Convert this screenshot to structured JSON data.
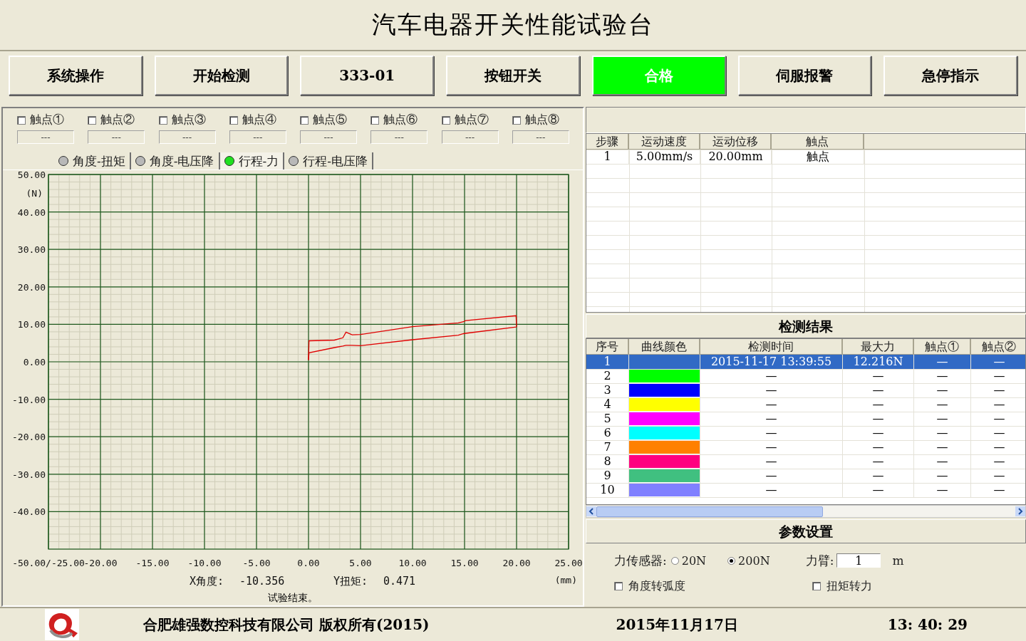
{
  "title": "汽车电器开关性能试验台",
  "buttons": [
    {
      "label": "系统操作",
      "active": false
    },
    {
      "label": "开始检测",
      "active": false
    },
    {
      "label": "333-01",
      "active": false
    },
    {
      "label": "按钮开关",
      "active": false
    },
    {
      "label": "合格",
      "active": true
    },
    {
      "label": "伺服报警",
      "active": false
    },
    {
      "label": "急停指示",
      "active": false
    }
  ],
  "contacts": [
    {
      "label": "触点①",
      "checked": false,
      "value": "---"
    },
    {
      "label": "触点②",
      "checked": false,
      "value": "---"
    },
    {
      "label": "触点③",
      "checked": false,
      "value": "---"
    },
    {
      "label": "触点④",
      "checked": false,
      "value": "---"
    },
    {
      "label": "触点⑤",
      "checked": false,
      "value": "---"
    },
    {
      "label": "触点⑥",
      "checked": false,
      "value": "---"
    },
    {
      "label": "触点⑦",
      "checked": false,
      "value": "---"
    },
    {
      "label": "触点⑧",
      "checked": false,
      "value": "---"
    }
  ],
  "chart_tabs": [
    {
      "label": "角度-扭矩",
      "selected": false
    },
    {
      "label": "角度-电压降",
      "selected": false
    },
    {
      "label": "行程-力",
      "selected": true
    },
    {
      "label": "行程-电压降",
      "selected": false
    }
  ],
  "chart": {
    "chart_data": {
      "type": "line",
      "xlabel": "(mm)",
      "ylabel": "(N)",
      "xlim": [
        -25,
        25
      ],
      "ylim": [
        -50,
        50
      ],
      "xticks": [
        {
          "value": -25,
          "label": "-50.00/-25.00"
        },
        {
          "value": -20,
          "label": "-20.00"
        },
        {
          "value": -15,
          "label": "-15.00"
        },
        {
          "value": -10,
          "label": "-10.00"
        },
        {
          "value": -5,
          "label": "-5.00"
        },
        {
          "value": 0,
          "label": "0.00"
        },
        {
          "value": 5,
          "label": "5.00"
        },
        {
          "value": 10,
          "label": "10.00"
        },
        {
          "value": 15,
          "label": "15.00"
        },
        {
          "value": 20,
          "label": "20.00"
        },
        {
          "value": 25,
          "label": "25.00"
        }
      ],
      "yticks": [
        {
          "value": 50,
          "label": "50.00"
        },
        {
          "value": 40,
          "label": "40.00"
        },
        {
          "value": 30,
          "label": "30.00"
        },
        {
          "value": 20,
          "label": "20.00"
        },
        {
          "value": 10,
          "label": "10.00"
        },
        {
          "value": 0,
          "label": "0.00"
        },
        {
          "value": -10,
          "label": "-10.00"
        },
        {
          "value": -20,
          "label": "-20.00"
        },
        {
          "value": -30,
          "label": "-30.00"
        },
        {
          "value": -40,
          "label": "-40.00"
        }
      ],
      "grid": true,
      "x": [
        0,
        0.05,
        2.5,
        3.3,
        3.6,
        4.2,
        5,
        10,
        14.4,
        14.9,
        15.1,
        19.95,
        20
      ],
      "series": [
        {
          "color": "#e00000",
          "values": [
            0.5,
            5.6,
            5.8,
            6.4,
            7.9,
            7.2,
            7.3,
            9.4,
            10.4,
            10.7,
            11.0,
            12.3,
            9.4
          ]
        },
        {
          "color": "#e00000",
          "values": [
            0.5,
            2.4,
            3.8,
            4.2,
            4.4,
            4.4,
            4.3,
            5.9,
            7.1,
            7.5,
            7.6,
            9.3,
            9.4
          ]
        }
      ]
    },
    "readouts": [
      {
        "label": "X角度:",
        "value": "-10.356"
      },
      {
        "label": "Y扭矩:",
        "value": "0.471"
      }
    ]
  },
  "status": "试验结束。",
  "steps": {
    "columns": [
      "步骤",
      "运动速度",
      "运动位移",
      "触点"
    ],
    "rows": [
      [
        "1",
        "5.00mm/s",
        "20.00mm",
        "触点"
      ]
    ]
  },
  "results": {
    "title": "检测结果",
    "columns": [
      "序号",
      "曲线颜色",
      "检测时间",
      "最大力",
      "触点①",
      "触点②"
    ],
    "rows": [
      {
        "cells": [
          "1",
          "",
          "2015-11-17 13:39:55",
          "12.216N",
          "—",
          "—"
        ],
        "selected": true
      },
      {
        "cells": [
          "2",
          "",
          "—",
          "—",
          "—",
          "—"
        ],
        "color": "#00ff00",
        "selected": false
      },
      {
        "cells": [
          "3",
          "",
          "—",
          "—",
          "—",
          "—"
        ],
        "color": "#0000ff",
        "selected": false
      },
      {
        "cells": [
          "4",
          "",
          "—",
          "—",
          "—",
          "—"
        ],
        "color": "#ffff00",
        "selected": false
      },
      {
        "cells": [
          "5",
          "",
          "—",
          "—",
          "—",
          "—"
        ],
        "color": "#ff00ff",
        "selected": false
      },
      {
        "cells": [
          "6",
          "",
          "—",
          "—",
          "—",
          "—"
        ],
        "color": "#00ffff",
        "selected": false
      },
      {
        "cells": [
          "7",
          "",
          "—",
          "—",
          "—",
          "—"
        ],
        "color": "#ff8000",
        "selected": false
      },
      {
        "cells": [
          "8",
          "",
          "—",
          "—",
          "—",
          "—"
        ],
        "color": "#ff0080",
        "selected": false
      },
      {
        "cells": [
          "9",
          "",
          "—",
          "—",
          "—",
          "—"
        ],
        "color": "#40c080",
        "selected": false
      },
      {
        "cells": [
          "10",
          "",
          "—",
          "—",
          "—",
          "—"
        ],
        "color": "#8080ff",
        "selected": false
      }
    ]
  },
  "params": {
    "title": "参数设置",
    "sensor_label": "力传感器:",
    "sensor_options": [
      {
        "label": "20N",
        "selected": false
      },
      {
        "label": "200N",
        "selected": true
      }
    ],
    "arm_label": "力臂:",
    "arm_value": "1",
    "arm_unit": "m",
    "options": [
      {
        "label": "角度转弧度",
        "checked": false
      },
      {
        "label": "扭矩转力",
        "checked": false
      }
    ]
  },
  "footer": {
    "company": "合肥雄强数控科技有限公司 版权所有(2015)",
    "date": "2015年11月17日",
    "time": "13: 40: 29"
  }
}
